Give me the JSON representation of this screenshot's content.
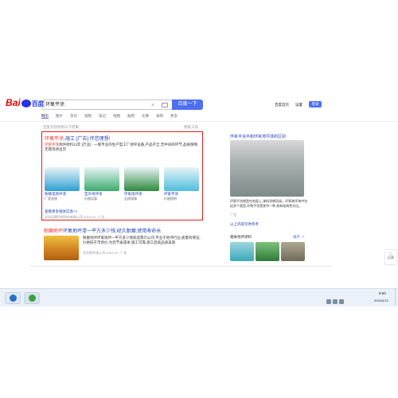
{
  "baidu": {
    "logo_text_1": "Bai",
    "logo_text_2": "百度",
    "search_value": "环氧平涂",
    "clear_icon": "×",
    "search_button": "百度一下",
    "top_links": [
      "百度首页",
      "设置"
    ],
    "login": "登录",
    "tabs": [
      "网页",
      "图片",
      "资讯",
      "视频",
      "笔记",
      "地图",
      "贴吧",
      "文库",
      "采购",
      "更多"
    ],
    "hint": "百度为您找到以下结果",
    "tools": "搜索工具"
  },
  "result1": {
    "title_kw": "环氧平涂",
    "title_rest": "-施工 [广告] 伴您理想!",
    "desc_kw": "环氧平涂",
    "desc_rest": "地坪材料12年 [行业] · 一家专业的生产型工厂地坪设备,产品齐全,无中间商环节,品质保障,无需等待出货",
    "thumbs": [
      {
        "caption": "防静电地坪漆",
        "sub": "厂家直销",
        "color": "#2e9fd0"
      },
      {
        "caption": "室外地坪漆",
        "sub": "价格实惠",
        "color": "#3dab6c"
      },
      {
        "caption": "环氧地坪漆",
        "sub": "品质保障",
        "color": "#2f8a3e"
      },
      {
        "caption": "环氧平涂",
        "sub": "价格透明",
        "color": "#4fbede"
      }
    ],
    "more": "查看更多相关信息>>",
    "source": "北京品牌环保科技有限公司 2024-03 · 广告"
  },
  "result2": {
    "title_kw": "耐磨地坪",
    "title_mid": "环氧地坪漆",
    "title_rest": "一平方多少钱,经久耐磨,使用寿命长",
    "desc": "耐磨地坪环氧地坪一平方多少钱就选我们公司,专业于地坪行业,质量有保证,价格低于市场价,为您节省成本,施工可靠,施工后高品质美观",
    "source": "北京地坪漆公司 2024-03 · 广告"
  },
  "sidebar": {
    "title": "环氧平涂平和环氧地坪漆的区别",
    "text": "环氧平涂就是在地面上,漆料涂刷而成。环氧地坪漆中包括多个类型,环氧平涂是其中一种,具有较高性价比。",
    "source": "广告",
    "tag": "以上内容仅供参考",
    "related": "相关地坪涂料",
    "more": "展开 ∨"
  },
  "feedback": {
    "label": "反馈"
  },
  "taskbar": {
    "time": "9:50",
    "date": "2024/4/12"
  },
  "colors": {
    "accent": "#4e6ef2",
    "highlight_box": "#e02020",
    "link": "#2440b3",
    "keyword": "#f73131"
  }
}
